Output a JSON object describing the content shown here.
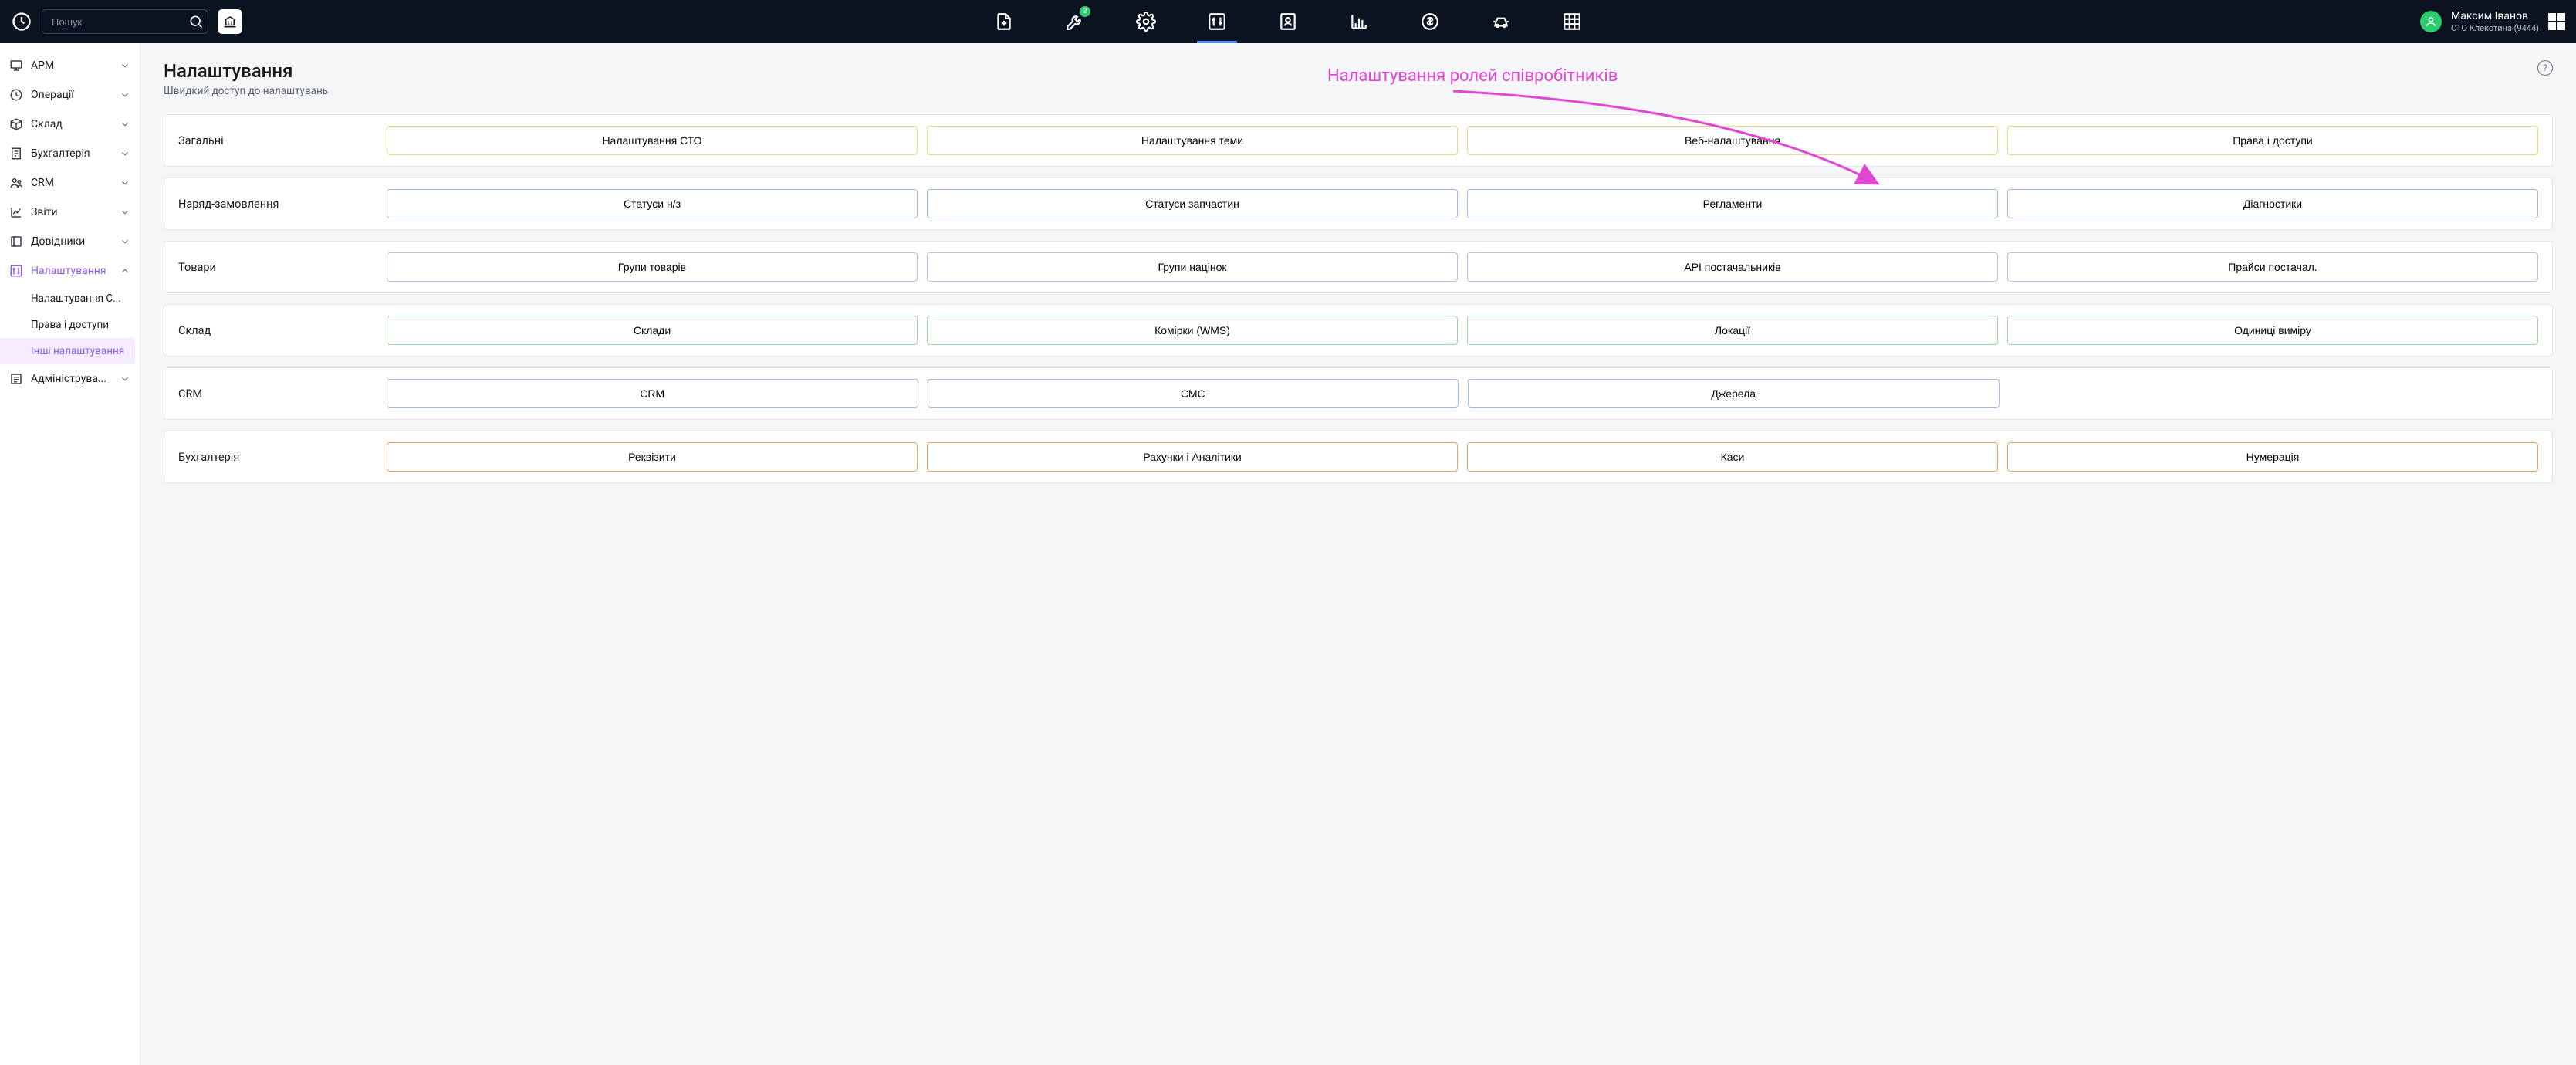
{
  "search": {
    "placeholder": "Пошук"
  },
  "topbar": {
    "badge_count": "3",
    "user_name": "Максим Іванов",
    "user_org": "СТО Клекотина (9444)"
  },
  "sidebar": {
    "items": [
      {
        "label": "АРМ"
      },
      {
        "label": "Операції"
      },
      {
        "label": "Склад"
      },
      {
        "label": "Бухгалтерія"
      },
      {
        "label": "CRM"
      },
      {
        "label": "Звіти"
      },
      {
        "label": "Довідники"
      },
      {
        "label": "Налаштування"
      },
      {
        "label": "Адмініструва..."
      }
    ],
    "subitems": [
      {
        "label": "Налаштування С..."
      },
      {
        "label": "Права і доступи"
      },
      {
        "label": "Інші налаштування"
      }
    ]
  },
  "page": {
    "title": "Налаштування",
    "subtitle": "Швидкий доступ до налаштувань",
    "help": "?"
  },
  "annotation": {
    "text": "Налаштування ролей співробітників"
  },
  "sections": [
    {
      "label": "Загальні",
      "color": "yellow",
      "buttons": [
        "Налаштування СТО",
        "Налаштування теми",
        "Веб-налаштування",
        "Права і доступи"
      ]
    },
    {
      "label": "Наряд-замовлення",
      "color": "blue",
      "buttons": [
        "Статуси н/з",
        "Статуси запчастин",
        "Регламенти",
        "Діагностики"
      ]
    },
    {
      "label": "Товари",
      "color": "purple",
      "buttons": [
        "Групи товарів",
        "Групи націнок",
        "API постачальників",
        "Прайси постачал."
      ]
    },
    {
      "label": "Склад",
      "color": "green",
      "buttons": [
        "Склади",
        "Комірки (WMS)",
        "Локації",
        "Одиниці виміру"
      ]
    },
    {
      "label": "CRM",
      "color": "blue",
      "buttons": [
        "CRM",
        "СМС",
        "Джерела",
        ""
      ]
    },
    {
      "label": "Бухгалтерія",
      "color": "orange",
      "buttons": [
        "Реквізити",
        "Рахунки і Аналітики",
        "Каси",
        "Нумерація"
      ]
    }
  ]
}
